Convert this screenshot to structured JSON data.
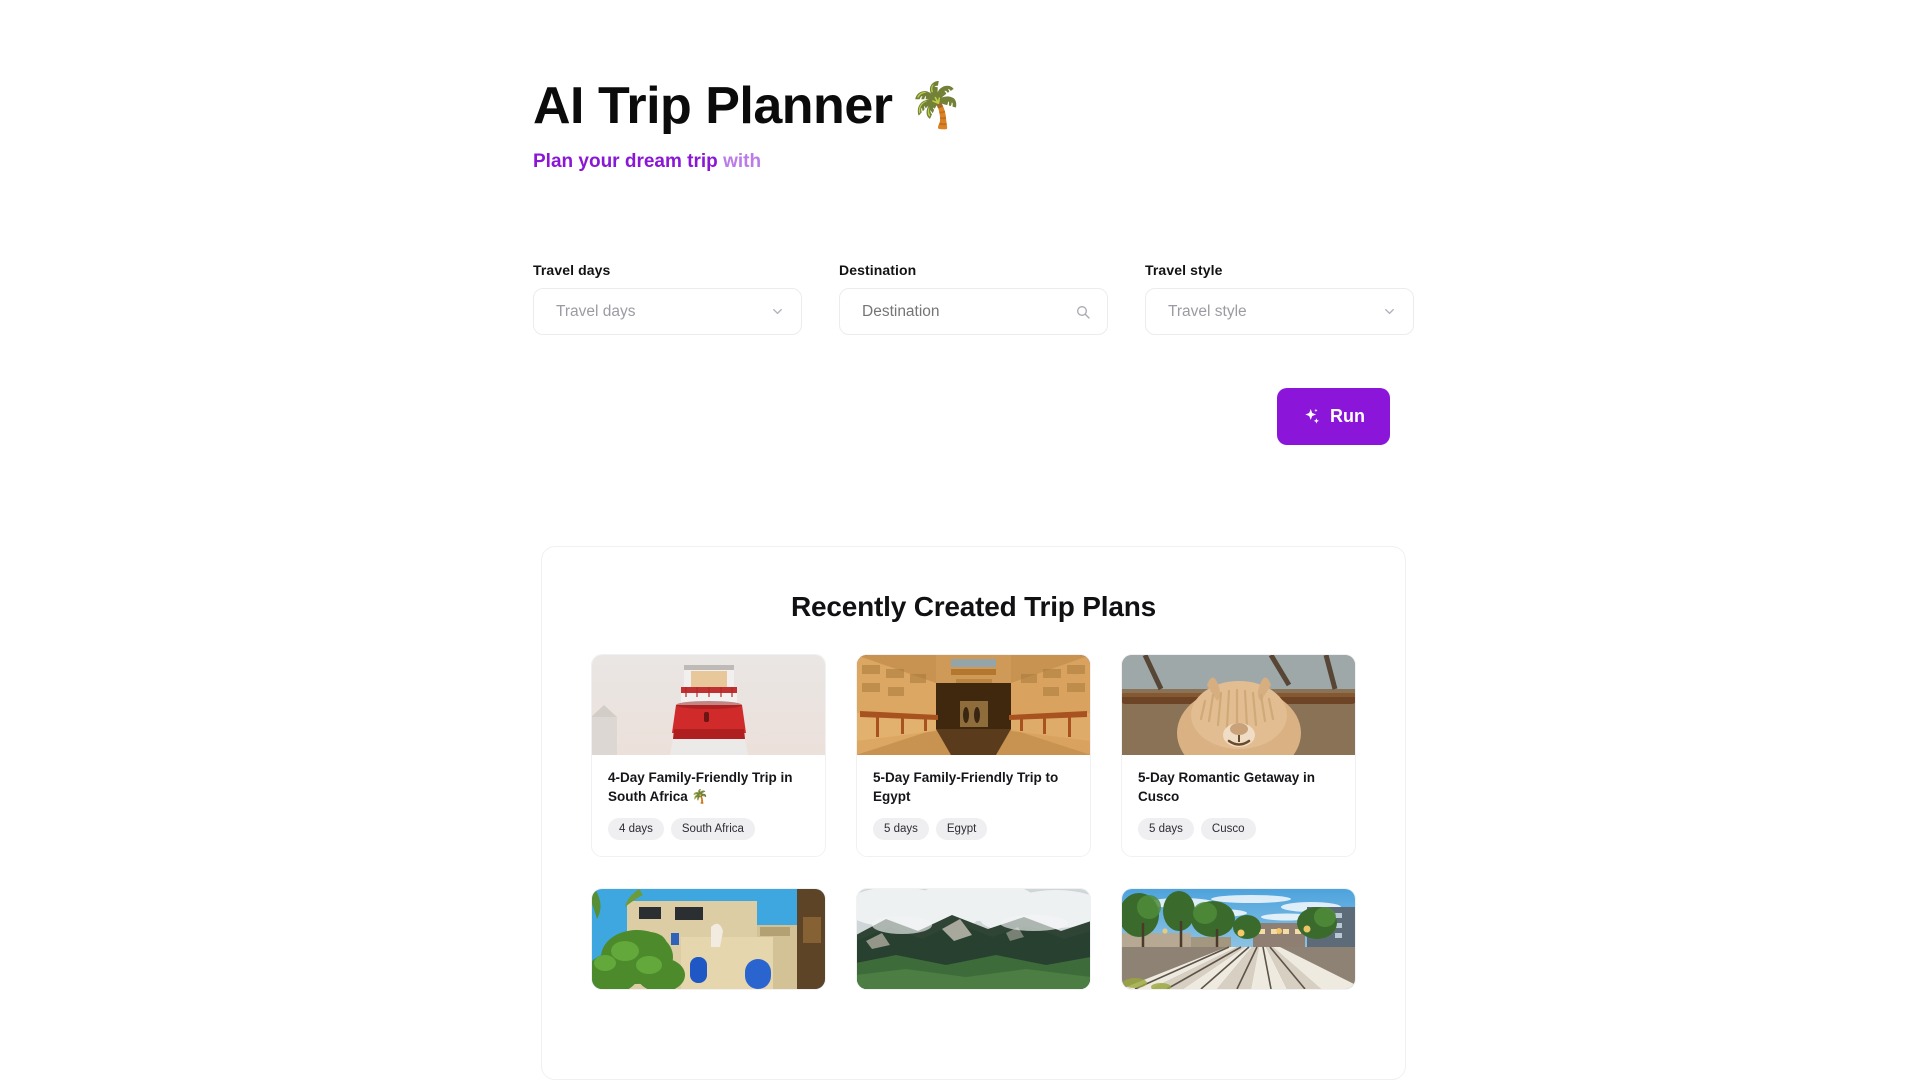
{
  "header": {
    "title": "AI Trip Planner",
    "title_emoji": "🌴",
    "subtitle_strong": "Plan your dream trip",
    "subtitle_faded": "with"
  },
  "form": {
    "fields": [
      {
        "label": "Travel days",
        "placeholder": "Travel days",
        "control": "select",
        "icon": "chevron-down-icon"
      },
      {
        "label": "Destination",
        "placeholder": "Destination",
        "control": "search",
        "icon": "search-icon"
      },
      {
        "label": "Travel style",
        "placeholder": "Travel style",
        "control": "select",
        "icon": "chevron-down-icon"
      }
    ],
    "run_label": "Run",
    "run_icon": "sparkle-icon",
    "run_color": "#8b16d9"
  },
  "recent": {
    "title": "Recently Created Trip Plans",
    "cards": [
      {
        "title": "4-Day Family-Friendly Trip in South Africa 🌴",
        "tags": [
          "4 days",
          "South Africa"
        ],
        "image": "lighthouse"
      },
      {
        "title": "5-Day Family-Friendly Trip to Egypt",
        "tags": [
          "5 days",
          "Egypt"
        ],
        "image": "egypt-corridor"
      },
      {
        "title": "5-Day Romantic Getaway in Cusco",
        "tags": [
          "5 days",
          "Cusco"
        ],
        "image": "alpaca"
      },
      {
        "title": "",
        "tags": [],
        "image": "stone-building"
      },
      {
        "title": "",
        "tags": [],
        "image": "green-mountains"
      },
      {
        "title": "",
        "tags": [],
        "image": "city-tram-street"
      }
    ]
  }
}
